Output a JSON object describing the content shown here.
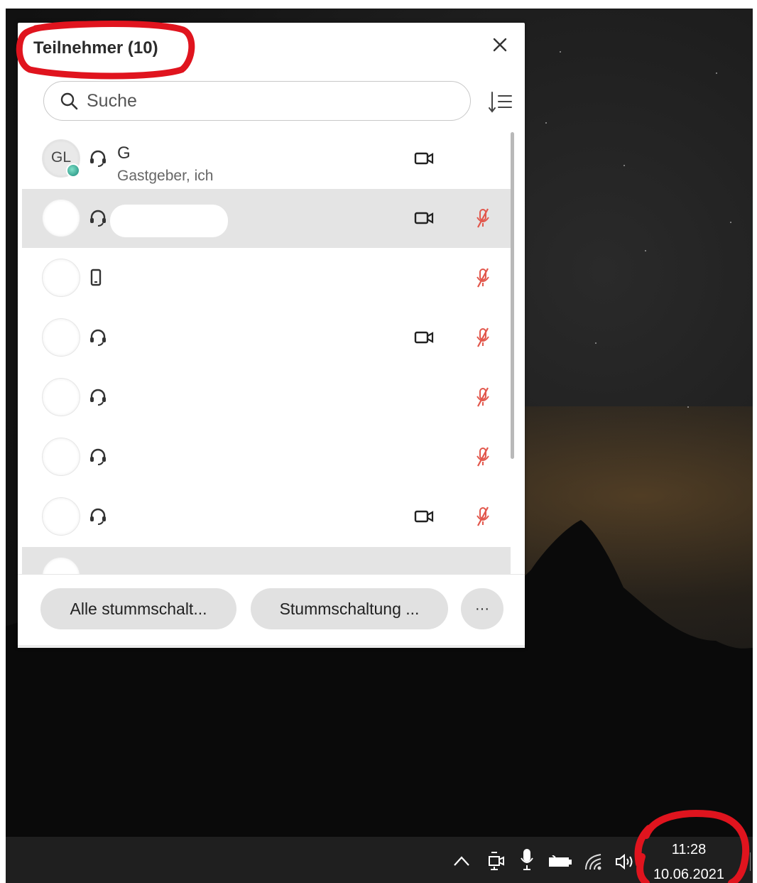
{
  "panel": {
    "title": "Teilnehmer (10)",
    "search_placeholder": "Suche"
  },
  "participants": [
    {
      "initials": "GL",
      "name": "G",
      "role": "Gastgeber, ich",
      "device": "headset-icon",
      "video": true,
      "muted": false,
      "highlighted": false
    },
    {
      "initials": "",
      "name": "",
      "role": "",
      "device": "headset-icon",
      "video": true,
      "muted": true,
      "highlighted": true
    },
    {
      "initials": "",
      "name": "",
      "role": "",
      "device": "phone-icon",
      "video": false,
      "muted": true,
      "highlighted": false
    },
    {
      "initials": "",
      "name": "",
      "role": "",
      "device": "headset-icon",
      "video": true,
      "muted": true,
      "highlighted": false
    },
    {
      "initials": "",
      "name": "",
      "role": "",
      "device": "headset-icon",
      "video": false,
      "muted": true,
      "highlighted": false
    },
    {
      "initials": "",
      "name": "",
      "role": "",
      "device": "headset-icon",
      "video": false,
      "muted": true,
      "highlighted": false
    },
    {
      "initials": "",
      "name": "",
      "role": "",
      "device": "headset-icon",
      "video": true,
      "muted": true,
      "highlighted": false
    }
  ],
  "footer": {
    "mute_all_label": "Alle stummschalt...",
    "unmute_label": "Stummschaltung ...",
    "more_label": "···"
  },
  "taskbar": {
    "time": "11:28",
    "date": "10.06.2021",
    "icons": [
      "chevron-up-icon",
      "meeting-icon",
      "microphone-icon",
      "battery-icon",
      "wifi-icon",
      "speaker-icon"
    ]
  },
  "colors": {
    "muted_mic": "#e2574c",
    "highlight_row": "#e4e4e4",
    "annotation": "#e0141e"
  }
}
